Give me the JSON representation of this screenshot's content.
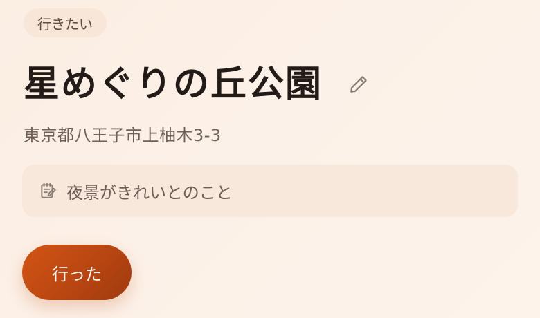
{
  "status_tag": "行きたい",
  "place": {
    "name": "星めぐりの丘公園",
    "address": "東京都八王子市上柚木3-3",
    "memo": "夜景がきれいとのこと"
  },
  "actions": {
    "visited_label": "行った",
    "edit_icon": "pencil-icon",
    "memo_icon": "note-icon"
  },
  "colors": {
    "accent": "#c84e14",
    "background": "#fcf1e8",
    "memo_background": "#f7e8db",
    "tag_background": "#f8e6d8"
  }
}
